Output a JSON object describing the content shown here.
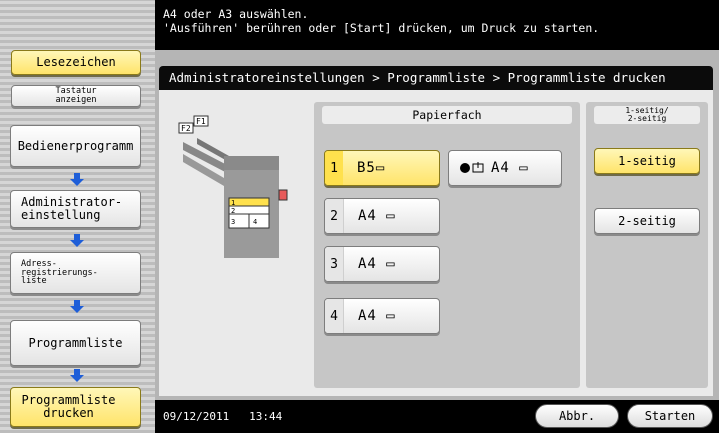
{
  "message": {
    "line1": "A4 oder A3 auswählen.",
    "line2": "'Ausführen' berühren oder [Start] drücken, um Druck zu starten."
  },
  "sidebar": {
    "bookmark_label": "Lesezeichen",
    "keyboard_label": "Tastatur anzeigen",
    "steps": [
      {
        "label": "Bedienerprogramm"
      },
      {
        "label": "Administrator-einstellung"
      },
      {
        "label": "Adress-registrierungs-liste"
      },
      {
        "label": "Programmliste"
      },
      {
        "label": "Programmliste drucken"
      }
    ]
  },
  "breadcrumb": "Administratoreinstellungen > Programmliste > Programmliste drucken",
  "paper": {
    "header": "Papierfach",
    "trays": [
      {
        "number": "1",
        "size": "B5▭",
        "selected": true
      },
      {
        "number": "2",
        "size": "A4 ▭",
        "selected": false
      },
      {
        "number": "3",
        "size": "A4 ▭",
        "selected": false
      },
      {
        "number": "4",
        "size": "A4 ▭",
        "selected": false
      }
    ],
    "bypass_size": "A4 ▭"
  },
  "duplex": {
    "header_line1": "1-seitig/",
    "header_line2": "2-seitig",
    "options": [
      {
        "label": "1-seitig",
        "selected": true
      },
      {
        "label": "2-seitig",
        "selected": false
      }
    ]
  },
  "diagram": {
    "f1_label": "F1",
    "f2_label": "F2",
    "slots": [
      "1",
      "2",
      "3",
      "4"
    ]
  },
  "footer": {
    "date": "09/12/2011",
    "time": "13:44",
    "cancel_label": "Abbr.",
    "start_label": "Starten"
  },
  "colors": {
    "selected_yellow": "#ffe14d",
    "arrow_blue": "#1e5ed8",
    "bypass_pink": "#e85a5a"
  }
}
